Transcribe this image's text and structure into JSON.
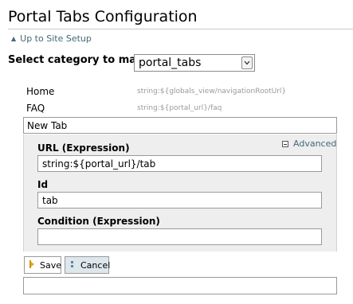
{
  "page": {
    "title": "Portal Tabs Configuration"
  },
  "nav": {
    "up_link": "Up to Site Setup"
  },
  "category": {
    "label": "Select category to manage",
    "selected": "portal_tabs"
  },
  "tabs": [
    {
      "name": "Home",
      "url": "string:${globals_view/navigationRootUrl}"
    },
    {
      "name": "FAQ",
      "url": "string:${portal_url}/faq"
    }
  ],
  "new_tab": {
    "title_value": "New Tab",
    "advanced_label": "Advanced",
    "url_label": "URL (Expression)",
    "url_value": "string:${portal_url}/tab",
    "id_label": "Id",
    "id_value": "tab",
    "condition_label": "Condition (Expression)",
    "condition_value": ""
  },
  "buttons": {
    "save": "Save",
    "cancel": "Cancel"
  },
  "colors": {
    "link": "#436976",
    "panel_bg": "#eeeeee",
    "cancel_bg": "#dde7ec",
    "save_icon": "#e2b020",
    "cancel_icon": "#5a86a6"
  }
}
